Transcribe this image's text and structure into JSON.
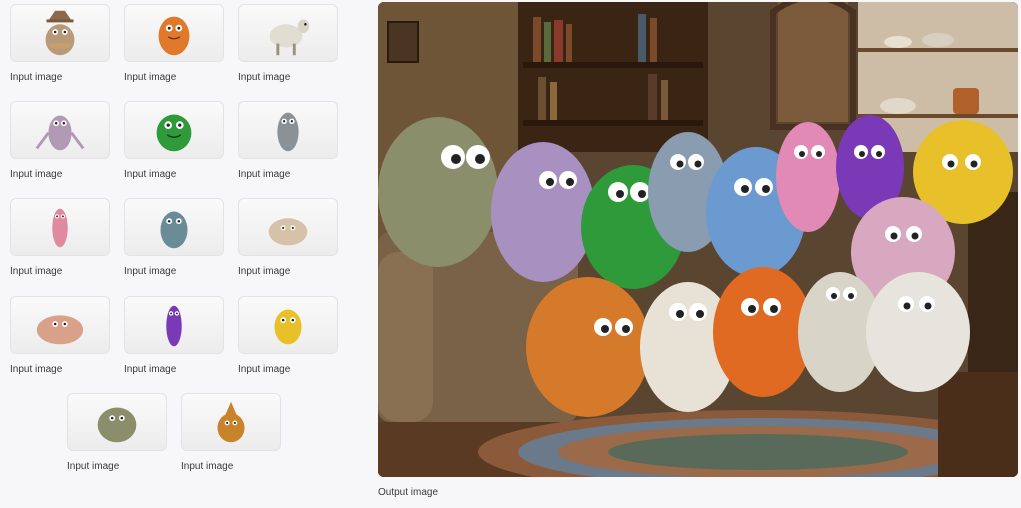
{
  "inputs": [
    {
      "label": "Input image",
      "creature": "scarecrow-monster",
      "color": "#b89a7a"
    },
    {
      "label": "Input image",
      "creature": "orange-monster",
      "color": "#e07a2a"
    },
    {
      "label": "Input image",
      "creature": "sheep",
      "color": "#d9d4c8"
    },
    {
      "label": "Input image",
      "creature": "lilac-monster",
      "color": "#b29ab5"
    },
    {
      "label": "Input image",
      "creature": "green-monster",
      "color": "#2e9a3a"
    },
    {
      "label": "Input image",
      "creature": "gray-monster",
      "color": "#8a9298"
    },
    {
      "label": "Input image",
      "creature": "pink-monster",
      "color": "#e08aa0"
    },
    {
      "label": "Input image",
      "creature": "teal-monster",
      "color": "#6a8c96"
    },
    {
      "label": "Input image",
      "creature": "beige-fluff",
      "color": "#d6c2a8"
    },
    {
      "label": "Input image",
      "creature": "peach-monster",
      "color": "#d9a08a"
    },
    {
      "label": "Input image",
      "creature": "purple-monster",
      "color": "#7a3ab8"
    },
    {
      "label": "Input image",
      "creature": "yellow-monster",
      "color": "#e8c02a"
    },
    {
      "label": "Input image",
      "creature": "olive-monster",
      "color": "#8a8e6a"
    },
    {
      "label": "Input image",
      "creature": "amber-monster",
      "color": "#c8842a"
    }
  ],
  "output": {
    "label": "Output image"
  }
}
